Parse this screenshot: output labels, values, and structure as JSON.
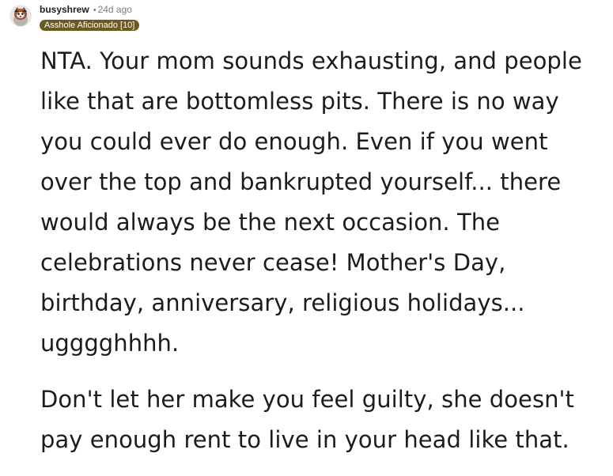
{
  "comment": {
    "author": {
      "username": "busyshrew",
      "separator": "•",
      "timestamp": "24d ago",
      "flair": "Asshole Aficionado [10]",
      "avatar_icon": "shrew-avatar-icon",
      "flair_color": "#6b5a1e"
    },
    "paragraphs": [
      "NTA. Your mom sounds exhausting, and people like that are bottomless pits. There is no way you could ever do enough. Even if you went over the top and bankrupted yourself... there would always be the next occasion. The celebrations never cease! Mother's Day, birthday, anniversary, religious holidays... ugggghhhh.",
      "Don't let her make you feel guilty, she doesn't pay enough rent to live in your head like that."
    ]
  }
}
